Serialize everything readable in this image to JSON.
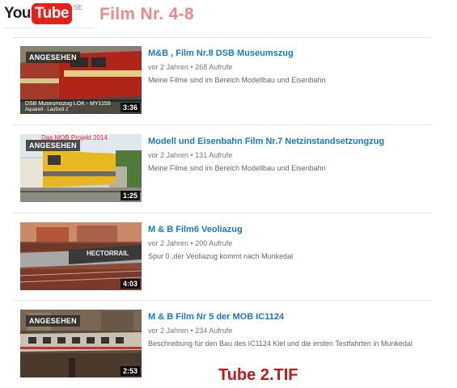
{
  "header": {
    "logo_you": "You",
    "logo_tube": "Tube",
    "logo_country": "SE",
    "title": "Film Nr. 4-8"
  },
  "footer_label": "Tube 2.TIF",
  "videos": [
    {
      "title": "M&B , Film Nr.8 DSB Museumszug",
      "age": "vor 2 Jahren",
      "views": "268 Aufrufe",
      "description": "Meine Filme sind im Bereich Modellbau und Eisenbahn",
      "watched": "ANGESEHEN",
      "duration": "3:36",
      "overlay1": "DSB Museumszug LOK - MY1159",
      "overlay2": "Aquarell - Laufzeit 2"
    },
    {
      "title": "Modell und Eisenbahn Film Nr.7 Netzinstandsetzungzug",
      "age": "vor 2 Jahren",
      "views": "131 Aufrufe",
      "description": "Meine Filme sind im Bereich Modellbau und Eisenbahn",
      "watched": "ANGESEHEN",
      "duration": "1:25",
      "overlay_top": "Das MOB Projekt 2014"
    },
    {
      "title": "M & B Film6 Veoliazug",
      "age": "vor 2 Jahren",
      "views": "200 Aufrufe",
      "description": "Spur 0 ,der Veoliazug kommt nach Munkedal",
      "watched": "",
      "duration": "4:03",
      "train_text": "HECTORRAIL"
    },
    {
      "title": "M & B Film Nr 5 der MOB IC1124",
      "age": "vor 2 Jahren",
      "views": "234 Aufrufe",
      "description": "Beschreibung für den Bau des IC1124 Kiel und die ersten Testfahrten in Munkedal",
      "watched": "ANGESEHEN",
      "duration": "2:53"
    }
  ],
  "colors": {
    "title_link": "#167ac6",
    "header_title": "#f08888",
    "footer_label": "#c5161b",
    "logo_red": "#e62117"
  }
}
